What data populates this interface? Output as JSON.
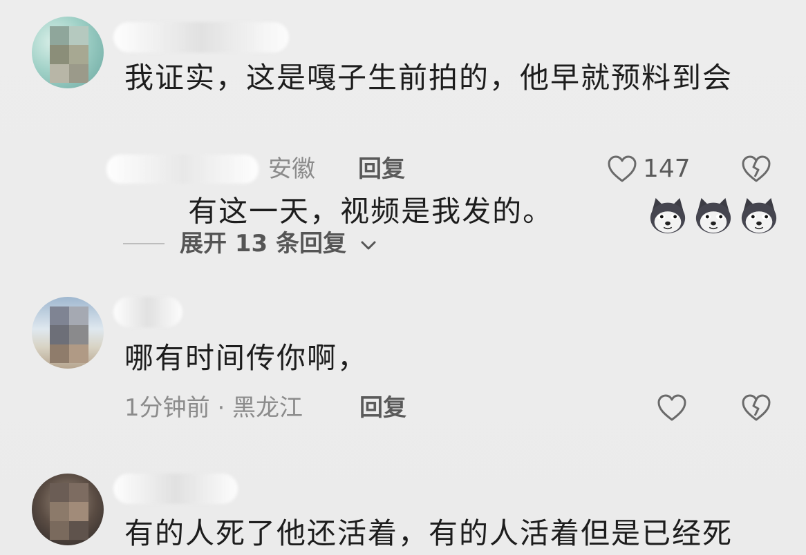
{
  "comments": [
    {
      "text_line1": "我证实，这是嘎子生前拍的，他早就预料到会",
      "text_line2": "有这一天，视频是我发的。",
      "location": "安徽",
      "reply_label": "回复",
      "like_count": "147",
      "emoji_count": 3,
      "emoji_name": "dog-emoji"
    },
    {
      "text": "哪有时间传你啊，",
      "meta": "1分钟前 · 黑龙江",
      "reply_label": "回复"
    },
    {
      "text": "有的人死了他还活着，有的人活着但是已经死"
    }
  ],
  "expand_replies": {
    "label": "展开 13 条回复"
  },
  "icons": {
    "like": "heart-outline-icon",
    "dislike": "broken-heart-icon",
    "chevron": "chevron-down-icon"
  }
}
